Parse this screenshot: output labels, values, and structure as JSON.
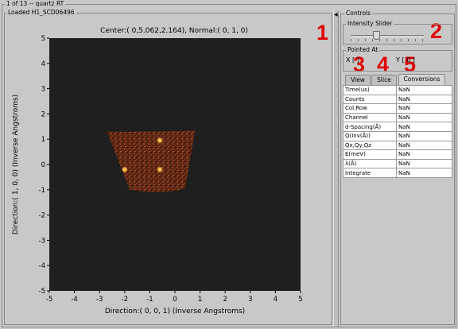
{
  "window": {
    "frame_title": "1 of 13 -- quartz RT",
    "plot_panel_title": "Loaded H1_SCD06496"
  },
  "plot": {
    "header": "Center:(   0,5.062,2.164), Normal:(   0,   1,   0)",
    "xlabel": "Direction:(   0,   0,   1)  (Inverse Angstroms)",
    "ylabel": "Direction:(   1,   0,   0)  (Inverse Angstroms)",
    "xticks": [
      "-5",
      "-4",
      "-3",
      "-2",
      "-1",
      "0",
      "1",
      "2",
      "3",
      "4",
      "5"
    ],
    "yticks": [
      "5",
      "4",
      "3",
      "2",
      "1",
      "0",
      "-1",
      "-2",
      "-3",
      "-4",
      "-5"
    ],
    "background_color": "#1f1f1f",
    "data_color": "#8a3a1c",
    "peak_color": "#ffcc55"
  },
  "chart_data": {
    "type": "heatmap",
    "xlabel": "Direction:(   0,   0,   1)  (Inverse Angstroms)",
    "ylabel": "Direction:(   1,   0,   0)  (Inverse Angstroms)",
    "xlim": [
      -5,
      5
    ],
    "ylim": [
      -5,
      5
    ],
    "detector_region": {
      "top_edge": [
        [
          -2.7,
          1.3
        ],
        [
          -1.0,
          1.1
        ],
        [
          0.8,
          1.35
        ]
      ],
      "bottom_edge": [
        [
          -1.8,
          -1.0
        ],
        [
          -0.5,
          -1.05
        ],
        [
          0.4,
          -0.95
        ]
      ]
    },
    "peaks": [
      {
        "x": -2.0,
        "y": -0.2
      },
      {
        "x": -0.6,
        "y": -0.2
      },
      {
        "x": -0.6,
        "y": 0.95
      }
    ]
  },
  "controls": {
    "title": "Controls",
    "intensity_slider": {
      "label": "Intensity Slider",
      "value": 0.35
    },
    "pointed_at": {
      "label": "Pointed At",
      "x_label": "X [ ]",
      "y_label": "Y [ 0 ]"
    },
    "tabs": [
      {
        "label": "View",
        "active": false
      },
      {
        "label": "Slice",
        "active": false
      },
      {
        "label": "Conversions",
        "active": true
      }
    ],
    "conversions": [
      {
        "name": "Time(us)",
        "value": "NaN"
      },
      {
        "name": "Counts",
        "value": "NaN"
      },
      {
        "name": "Col,Row",
        "value": "NaN"
      },
      {
        "name": "Channel",
        "value": "NaN"
      },
      {
        "name": "d-Spacing(Å)",
        "value": "NaN"
      },
      {
        "name": "Q(Inv(Å))",
        "value": "NaN"
      },
      {
        "name": "Qx,Qy,Qz",
        "value": "NaN"
      },
      {
        "name": "E(meV)",
        "value": "NaN"
      },
      {
        "name": "λ(Å)",
        "value": "NaN"
      },
      {
        "name": "Integrate",
        "value": "NaN"
      }
    ]
  },
  "callouts": [
    "1",
    "2",
    "3",
    "4",
    "5"
  ],
  "colors": {
    "callout": "#e00000",
    "panel_bg": "#c8c8c8"
  }
}
